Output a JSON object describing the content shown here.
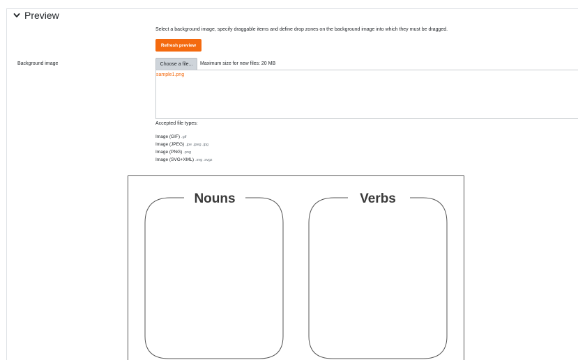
{
  "section": {
    "title": "Preview",
    "chevron_icon": "chevron-down-icon"
  },
  "intro_text": "Select a background image, specify draggable items and define drop zones on the background image into which they must be dragged.",
  "refresh_button": "Refresh preview",
  "background_image": {
    "label": "Background image",
    "choose_button": "Choose a file...",
    "max_size": "Maximum size for new files: 20 MB",
    "file_name": "sample1.png"
  },
  "accepted": {
    "title": "Accepted file types:",
    "types": [
      {
        "name": "Image (GIF)",
        "ext": ".gif"
      },
      {
        "name": "Image (JPEG)",
        "ext": ".jpe .jpeg .jpg"
      },
      {
        "name": "Image (PNG)",
        "ext": ".png"
      },
      {
        "name": "Image (SVG+XML)",
        "ext": ".svg .svgz"
      }
    ]
  },
  "preview_image": {
    "zone_labels": [
      "Nouns",
      "Verbs"
    ]
  },
  "colors": {
    "accent": "#f46a0f",
    "file_button": "#ced4da",
    "border": "#dee2e6"
  }
}
